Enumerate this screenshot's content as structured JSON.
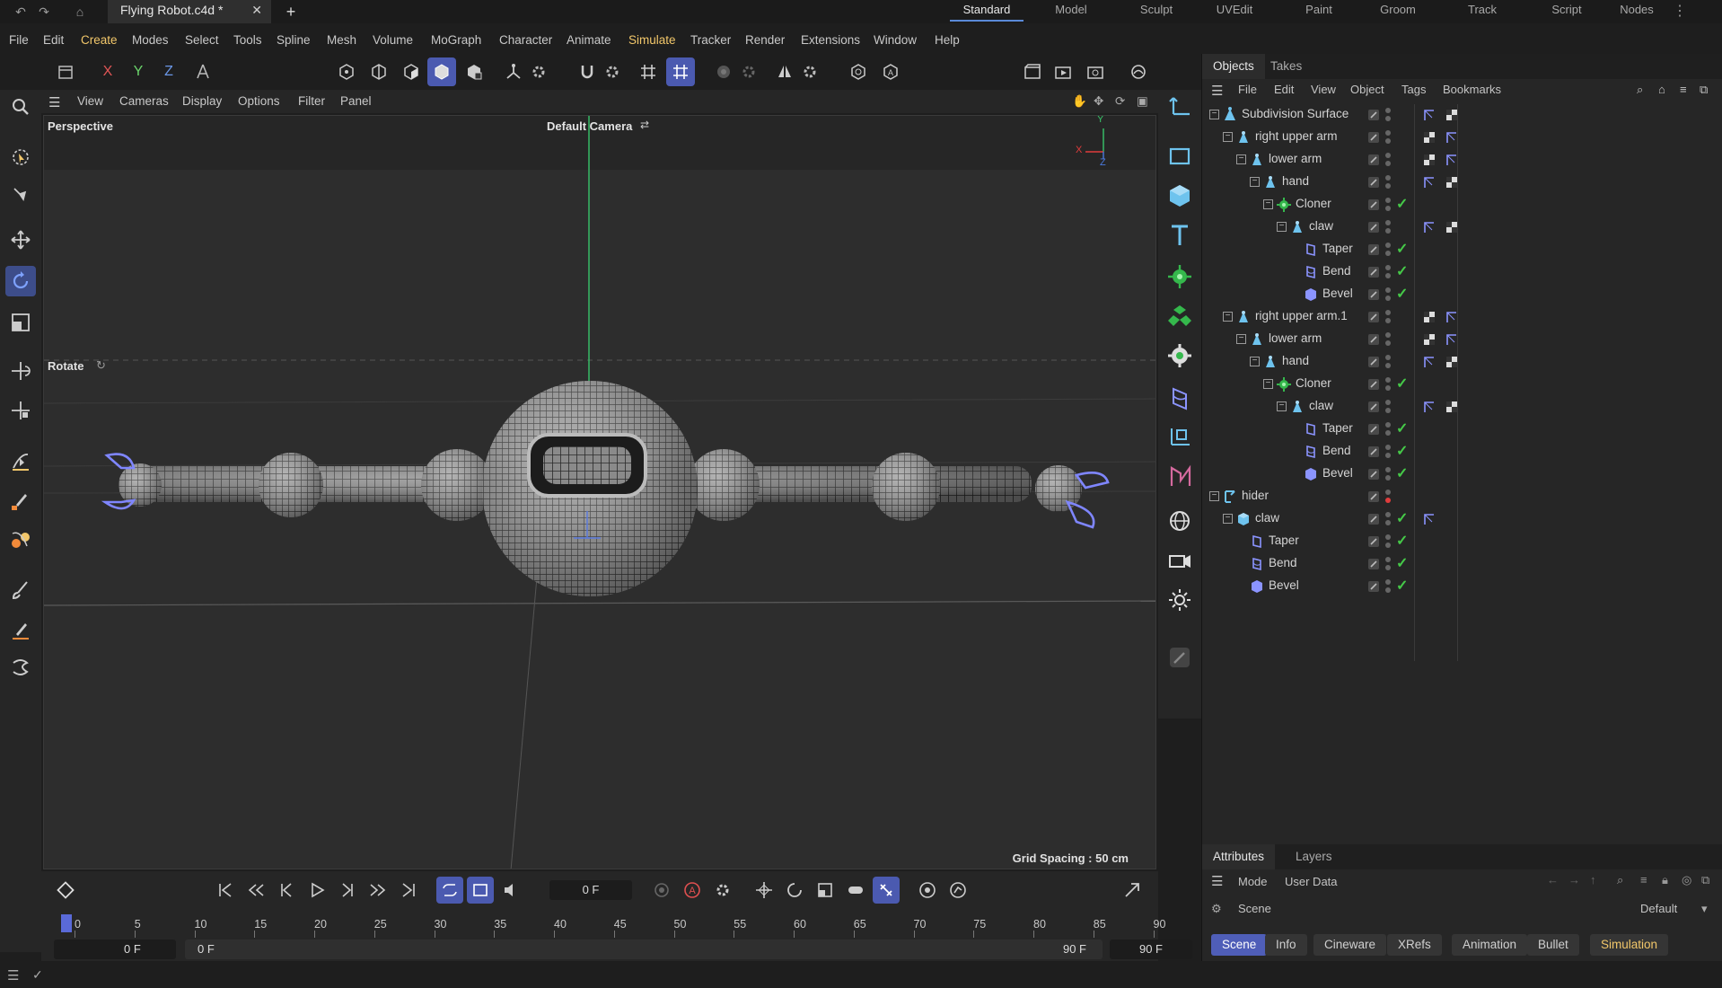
{
  "app": {
    "doc_title": "Flying Robot.c4d *",
    "layouts": [
      "Standard",
      "Model",
      "Sculpt",
      "UVEdit",
      "Paint",
      "Groom",
      "Track",
      "Script",
      "Nodes"
    ],
    "active_layout": "Standard"
  },
  "menubar": [
    "File",
    "Edit",
    "Create",
    "Modes",
    "Select",
    "Tools",
    "Spline",
    "Mesh",
    "Volume",
    "MoGraph",
    "Character",
    "Animate",
    "Simulate",
    "Tracker",
    "Render",
    "Extensions",
    "Window",
    "Help"
  ],
  "axis_labels": {
    "x": "X",
    "y": "Y",
    "z": "Z"
  },
  "viewport": {
    "menu": [
      "View",
      "Cameras",
      "Display",
      "Options",
      "Filter",
      "Panel"
    ],
    "projection": "Perspective",
    "camera": "Default Camera",
    "tool_label": "Rotate",
    "grid_spacing": "Grid Spacing : 50 cm",
    "gizmo": {
      "x": "X",
      "y": "Y",
      "z": "Z"
    }
  },
  "objects_panel": {
    "tabs": [
      "Objects",
      "Takes"
    ],
    "menu": [
      "File",
      "Edit",
      "View",
      "Object",
      "Tags",
      "Bookmarks"
    ],
    "rows": [
      {
        "label": "Subdivision Surface",
        "depth": 0,
        "icon": "subdivision-icon",
        "exp": "⊟",
        "tags": [
          "phong",
          "checker"
        ]
      },
      {
        "label": "right upper arm",
        "depth": 1,
        "icon": "null-icon",
        "exp": "⊟",
        "tags": [
          "checker",
          "phong"
        ]
      },
      {
        "label": "lower arm",
        "depth": 2,
        "icon": "null-icon",
        "exp": "⊟",
        "tags": [
          "checker",
          "phong"
        ]
      },
      {
        "label": "hand",
        "depth": 3,
        "icon": "null-icon",
        "exp": "⊟",
        "tags": [
          "phong",
          "checker"
        ]
      },
      {
        "label": "Cloner",
        "depth": 4,
        "icon": "cloner-icon",
        "exp": "⊟",
        "check": true,
        "tags": []
      },
      {
        "label": "claw",
        "depth": 5,
        "icon": "null-icon",
        "exp": "⊟",
        "tags": [
          "phong",
          "checker"
        ]
      },
      {
        "label": "Taper",
        "depth": 6,
        "icon": "taper-icon",
        "exp": "",
        "check": true,
        "tags": []
      },
      {
        "label": "Bend",
        "depth": 6,
        "icon": "bend-icon",
        "exp": "",
        "check": true,
        "tags": []
      },
      {
        "label": "Bevel",
        "depth": 6,
        "icon": "bevel-icon",
        "exp": "",
        "check": true,
        "tags": []
      },
      {
        "label": "right upper arm.1",
        "depth": 1,
        "icon": "null-icon",
        "exp": "⊟",
        "tags": [
          "checker",
          "phong"
        ]
      },
      {
        "label": "lower arm",
        "depth": 2,
        "icon": "null-icon",
        "exp": "⊟",
        "tags": [
          "checker",
          "phong"
        ]
      },
      {
        "label": "hand",
        "depth": 3,
        "icon": "null-icon",
        "exp": "⊟",
        "tags": [
          "phong",
          "checker"
        ]
      },
      {
        "label": "Cloner",
        "depth": 4,
        "icon": "cloner-icon",
        "exp": "⊟",
        "check": true,
        "tags": []
      },
      {
        "label": "claw",
        "depth": 5,
        "icon": "null-icon",
        "exp": "⊟",
        "tags": [
          "phong",
          "checker"
        ]
      },
      {
        "label": "Taper",
        "depth": 6,
        "icon": "taper-icon",
        "exp": "",
        "check": true,
        "tags": []
      },
      {
        "label": "Bend",
        "depth": 6,
        "icon": "bend-icon",
        "exp": "",
        "check": true,
        "tags": []
      },
      {
        "label": "Bevel",
        "depth": 6,
        "icon": "bevel-icon",
        "exp": "",
        "check": true,
        "tags": []
      },
      {
        "label": "hider",
        "depth": 0,
        "icon": "connect-icon",
        "exp": "⊟",
        "red": true,
        "tags": []
      },
      {
        "label": "claw",
        "depth": 1,
        "icon": "cube-icon",
        "exp": "⊟",
        "check": true,
        "tags": [
          "phong"
        ]
      },
      {
        "label": "Taper",
        "depth": 2,
        "icon": "taper-icon",
        "exp": "",
        "check": true,
        "tags": []
      },
      {
        "label": "Bend",
        "depth": 2,
        "icon": "bend-icon",
        "exp": "",
        "check": true,
        "tags": []
      },
      {
        "label": "Bevel",
        "depth": 2,
        "icon": "bevel-icon",
        "exp": "",
        "check": true,
        "tags": []
      }
    ]
  },
  "attributes_panel": {
    "tabs": [
      "Attributes",
      "Layers"
    ],
    "mode_label": "Mode",
    "user_data_label": "User Data",
    "scene_label": "Scene",
    "preset": "Default",
    "buttons": [
      "Scene",
      "Info",
      "Cineware",
      "XRefs",
      "Animation",
      "Bullet",
      "Simulation"
    ],
    "selected_button": "Scene"
  },
  "timeline": {
    "current_frame": "0 F",
    "ticks": [
      "0",
      "5",
      "10",
      "15",
      "20",
      "25",
      "30",
      "35",
      "40",
      "45",
      "50",
      "55",
      "60",
      "65",
      "70",
      "75",
      "80",
      "85",
      "90"
    ],
    "start_field": "0 F",
    "range_start": "0 F",
    "range_end": "90 F",
    "end_field": "90 F"
  },
  "colors": {
    "accent": "#4b5ab0",
    "highlight_menu": "#f2c76a",
    "check_green": "#45c948",
    "axis_y": "#38c56a",
    "axis_x": "#e03c3c",
    "axis_z": "#4a7ae0"
  }
}
